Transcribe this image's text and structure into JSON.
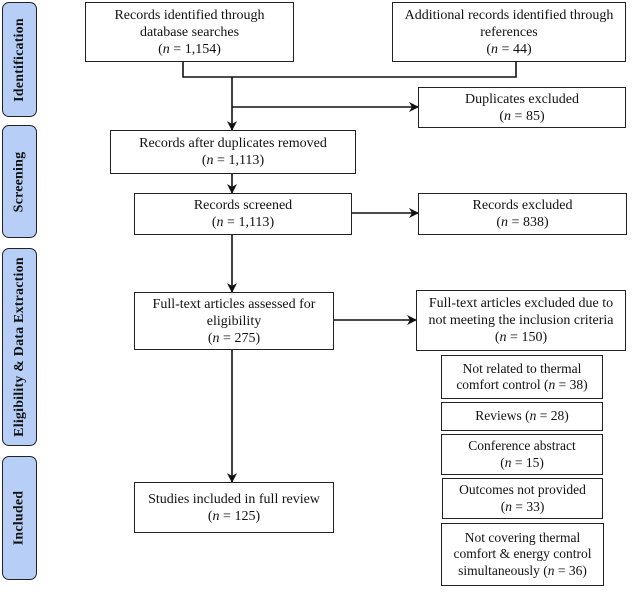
{
  "stages": [
    {
      "label": "Identification"
    },
    {
      "label": "Screening"
    },
    {
      "label": "Eligibility & Data Extraction"
    },
    {
      "label": "Included"
    }
  ],
  "boxes": {
    "database_search": {
      "text": "Records identified through database searches",
      "n": "1,154"
    },
    "references": {
      "text": "Additional records identified through references",
      "n": "44"
    },
    "duplicates_excluded": {
      "text": "Duplicates excluded",
      "n": "85"
    },
    "after_duplicates": {
      "text": "Records after duplicates removed",
      "n": "1,113"
    },
    "screened": {
      "text": "Records screened",
      "n": "1,113"
    },
    "records_excluded": {
      "text": "Records excluded",
      "n": "838"
    },
    "fulltext_assessed": {
      "text": "Full-text articles assessed for eligibility",
      "n": "275"
    },
    "fulltext_excluded": {
      "text": "Full-text articles excluded due to not meeting the inclusion criteria",
      "n": "150"
    },
    "included": {
      "text": "Studies included in full review",
      "n": "125"
    }
  },
  "exclusion_reasons": [
    {
      "text": "Not related to thermal comfort control",
      "n": "38"
    },
    {
      "text": "Reviews",
      "n": "28"
    },
    {
      "text": "Conference abstract",
      "n": "15"
    },
    {
      "text": "Outcomes not provided",
      "n": "33"
    },
    {
      "text": "Not covering thermal comfort & energy control simultaneously",
      "n": "36"
    }
  ],
  "n_symbol": "n"
}
